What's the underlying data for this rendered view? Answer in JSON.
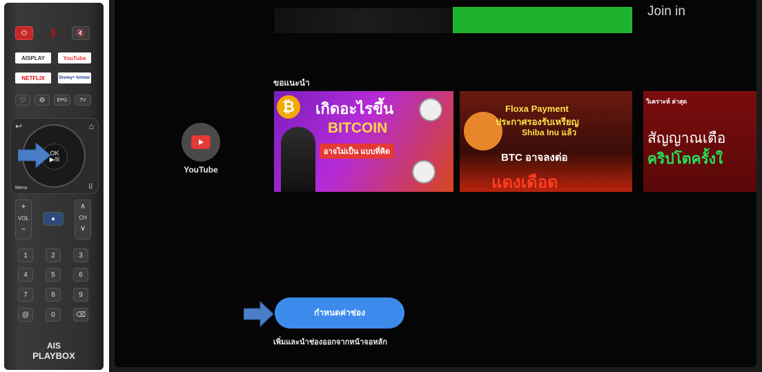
{
  "remote": {
    "top_buttons": {
      "mute_icon_label": "🔇"
    },
    "apps": [
      "AISPLAY",
      "YouTube",
      "NETFLIX",
      "Disney+ hotstar"
    ],
    "row_buttons": [
      "EPG",
      "TV"
    ],
    "ok_label": "OK",
    "play_pause": "▶/II",
    "menu_label": "Menu",
    "vol_label": "VOL",
    "ch_label": "CH",
    "numbers": [
      "1",
      "2",
      "3",
      "4",
      "5",
      "6",
      "7",
      "8",
      "9",
      "@",
      "0",
      "⌫"
    ],
    "brand_top": "AIS",
    "brand_bottom": "PLAYBOX"
  },
  "tv": {
    "join_text": "Join in",
    "youtube_label": "YouTube",
    "section_title": "ขอแนะนำ",
    "thumbnails": [
      {
        "line1": "เกิดอะไรขึ้น",
        "line2": "BITCOIN",
        "line3": "อาจไม่เป็น แบบที่คิด"
      },
      {
        "line1": "Floxa Payment",
        "line2": "ประกาศรองรับเหรียญ",
        "line3": "Shiba Inu แล้ว",
        "line4": "BTC อาจลงต่อ",
        "line5": "แดงเดือด"
      },
      {
        "line1": "วิเคราะห์ ล่าสุด",
        "line2": "สัญญาณเตือ",
        "line3": "คริปโตครั้งใ"
      }
    ],
    "cta_label": "กำหนดค่าช่อง",
    "cta_desc": "เพิ่มและนำช่องออกจากหน้าจอหลัก"
  },
  "colors": {
    "accent": "#3c8bec",
    "green": "#1db32f",
    "arrow": "#4a7fc8"
  }
}
